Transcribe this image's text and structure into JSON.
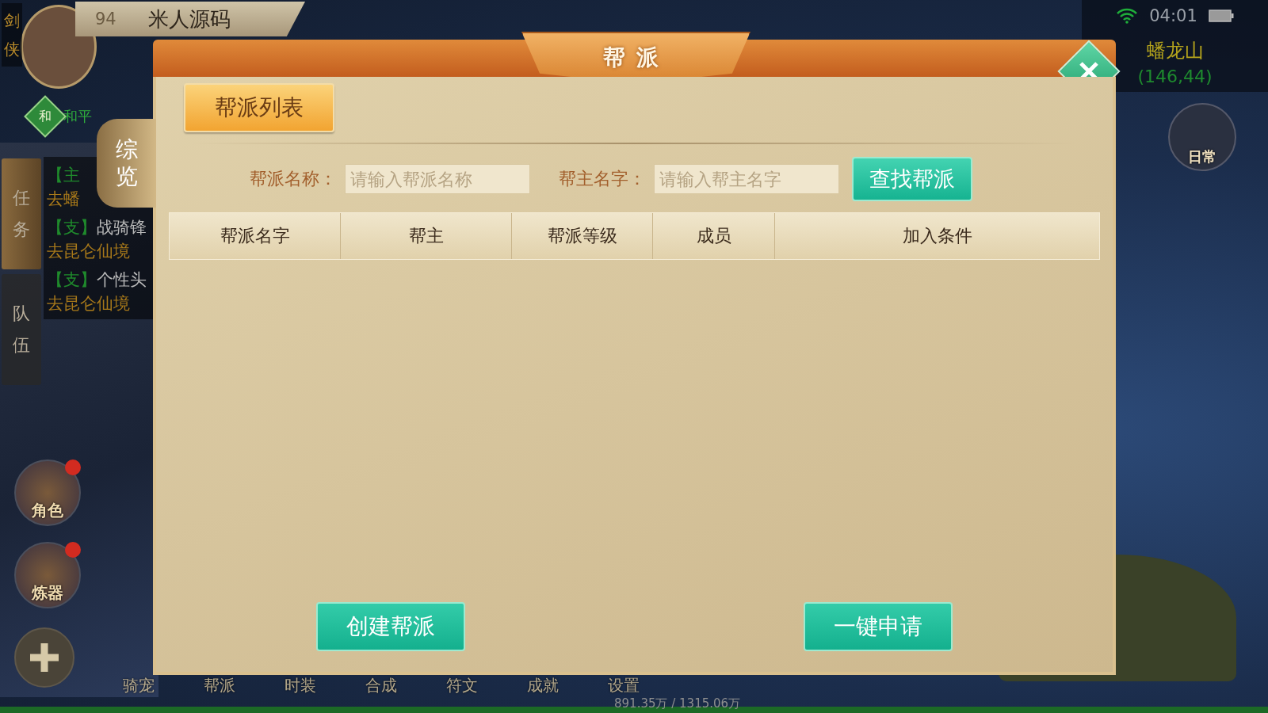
{
  "status_bar": {
    "time": "04:01"
  },
  "player": {
    "class_label": "剑侠",
    "level": "94",
    "name": "米人源码",
    "pk_mode": {
      "badge": "和",
      "label": "和平"
    }
  },
  "map": {
    "name": "蟠龙山",
    "coords": "(146,44)"
  },
  "daily": {
    "label": "日常"
  },
  "tracker": {
    "tabs": [
      {
        "label": "任务",
        "selected": true
      },
      {
        "label": "队伍",
        "selected": false
      }
    ],
    "quests": [
      {
        "tag": "【主",
        "target": "去蟠"
      },
      {
        "tag": "【支】",
        "title": "战骑锋",
        "target": "去昆仑仙境"
      },
      {
        "tag": "【支】",
        "title": "个性头",
        "target": "去昆仑仙境"
      }
    ]
  },
  "side_buttons": [
    {
      "label": "角色",
      "alert": true
    },
    {
      "label": "炼器",
      "alert": true
    }
  ],
  "bottom_menu": [
    "骑宠",
    "帮派",
    "时装",
    "合成",
    "符文",
    "成就",
    "设置"
  ],
  "exp": "891.35万 / 1315.06万",
  "dialog": {
    "title": "帮派",
    "side_tab": "综览",
    "tabs": [
      {
        "label": "帮派列表",
        "selected": true
      }
    ],
    "search": [
      {
        "label": "帮派名称：",
        "placeholder": "请输入帮派名称"
      },
      {
        "label": "帮主名字：",
        "placeholder": "请输入帮主名字"
      }
    ],
    "search_button": "查找帮派",
    "table": {
      "columns": [
        "帮派名字",
        "帮主",
        "帮派等级",
        "成员",
        "加入条件"
      ]
    },
    "buttons": [
      "创建帮派",
      "一键申请"
    ]
  }
}
